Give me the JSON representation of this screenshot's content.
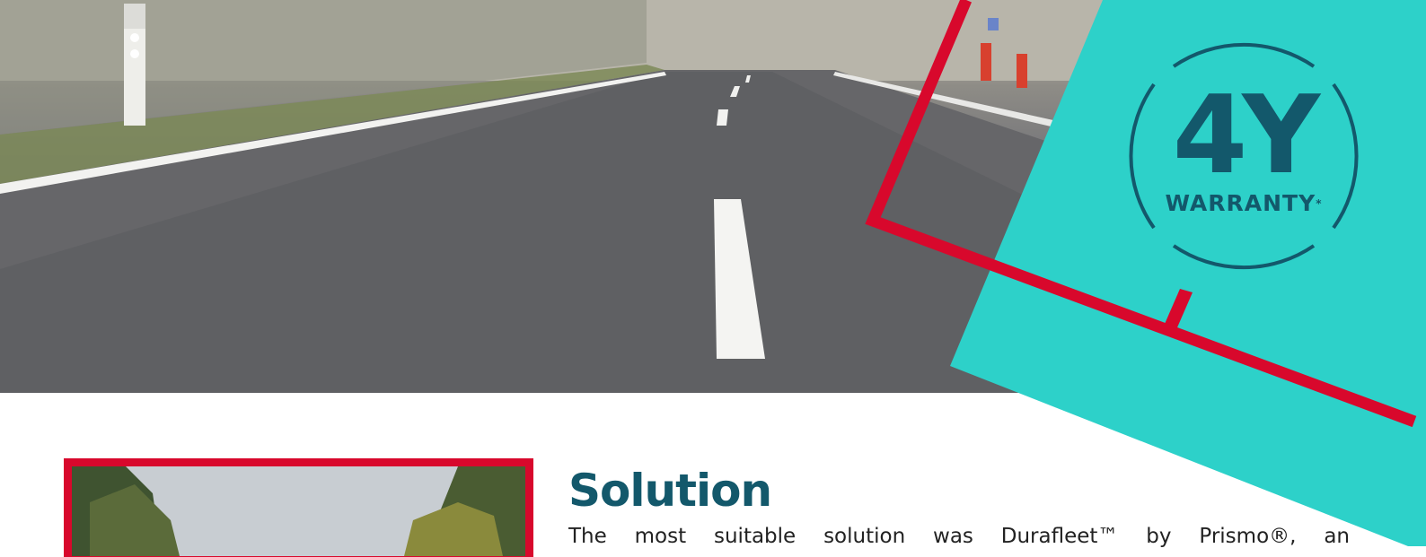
{
  "badge": {
    "main": "4Y",
    "sub": "WARRANTY",
    "star": "*"
  },
  "solution": {
    "heading": "Solution",
    "body": "The most suitable solution was Durafleet™ by Prismo®, an"
  },
  "colors": {
    "teal": "#2dd1c9",
    "navy": "#13586b",
    "red": "#d8082c"
  }
}
